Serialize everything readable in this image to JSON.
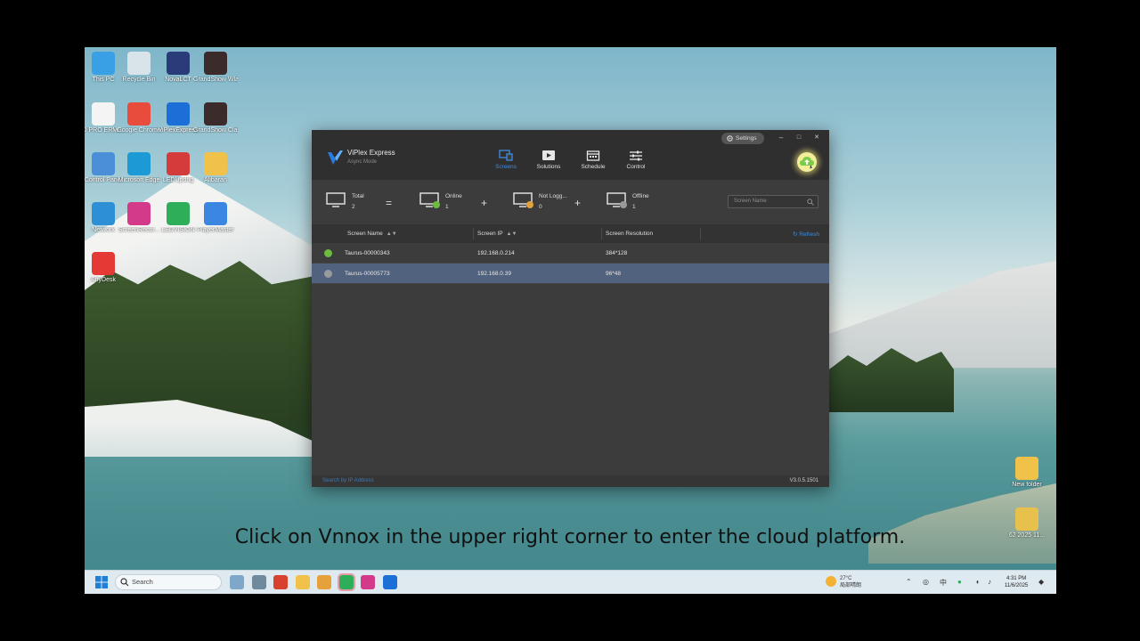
{
  "desktop": {
    "icons": [
      {
        "label": "This PC",
        "color": "#3aa0e6"
      },
      {
        "label": "Recycle Bin",
        "color": "#d8e4ea"
      },
      {
        "label": "NovaLCT",
        "color": "#2a3b7a"
      },
      {
        "label": "GrandShow Wlash",
        "color": "#3b2b2b"
      },
      {
        "label": "D PRO ERMi...",
        "color": "#f4f4f4"
      },
      {
        "label": "Google Chrome",
        "color": "#e74c3c"
      },
      {
        "label": "ViPlexExpress",
        "color": "#1c6fd6"
      },
      {
        "label": "GrandShow Classic Ed...",
        "color": "#3b2b2b"
      },
      {
        "label": "Control Panel",
        "color": "#4a8fd8"
      },
      {
        "label": "Microsoft Edge",
        "color": "#1b9ad6"
      },
      {
        "label": "LEDUpdng",
        "color": "#d43b3b"
      },
      {
        "label": "Alibaran",
        "color": "#f0c24a"
      },
      {
        "label": "Network",
        "color": "#2d8fd6"
      },
      {
        "label": "ScreenRecor...",
        "color": "#d33b8a"
      },
      {
        "label": "LEDVISION",
        "color": "#2fae5a"
      },
      {
        "label": "PlayerMaster",
        "color": "#3a86e0"
      },
      {
        "label": "AnyDesk",
        "color": "#e53935"
      }
    ],
    "right_icons": [
      {
        "label": "New folder",
        "color": "#f0c24a"
      },
      {
        "label": "62 2025 11...",
        "color": "#e8c14c"
      }
    ]
  },
  "app": {
    "name": "ViPlex Express",
    "mode": "Async Mode",
    "settings_label": "Settings",
    "minimize": "–",
    "maximize": "□",
    "close": "✕",
    "cloud_icon": "vnnox-cloud-icon",
    "nav": [
      {
        "label": "Screens",
        "icon": "screens-icon",
        "active": true
      },
      {
        "label": "Solutions",
        "icon": "solutions-icon",
        "active": false
      },
      {
        "label": "Schedule",
        "icon": "schedule-icon",
        "active": false
      },
      {
        "label": "Control",
        "icon": "control-icon",
        "active": false
      }
    ],
    "summary": {
      "total_label": "Total",
      "total_value": "2",
      "eq": "=",
      "online_label": "Online",
      "online_value": "1",
      "plus1": "+",
      "notlogged_label": "Not Logg...",
      "notlogged_value": "0",
      "plus2": "+",
      "offline_label": "Offline",
      "offline_value": "1"
    },
    "search_placeholder": "Screen Name",
    "table": {
      "headers": {
        "name": "Screen Name",
        "ip": "Screen IP",
        "resolution": "Screen Resolution",
        "sort": "▲▼"
      },
      "refresh": "Refresh",
      "rows": [
        {
          "name": "Taurus-00000343",
          "ip": "192.168.0.214",
          "resolution": "384*128",
          "status_color": "#6dbb3f"
        },
        {
          "name": "Taurus-00005773",
          "ip": "192.168.0.39",
          "resolution": "96*48",
          "status_color": "#9a9a9a"
        }
      ]
    },
    "footer": {
      "search_ip": "Search by IP Address",
      "version": "V3.0.5.1501"
    }
  },
  "caption": "Click on Vnnox in the upper right corner to enter the cloud platform.",
  "taskbar": {
    "search_label": "Search",
    "weather_temp": "27°C",
    "weather_desc": "局部晴朗",
    "ime": "中",
    "time": "4:31 PM",
    "date": "11/6/2025"
  },
  "colors": {
    "accent": "#3d8ee0",
    "online": "#6dbb3f",
    "selected_row": "#51627e",
    "window_bg": "#3c3c3c"
  }
}
